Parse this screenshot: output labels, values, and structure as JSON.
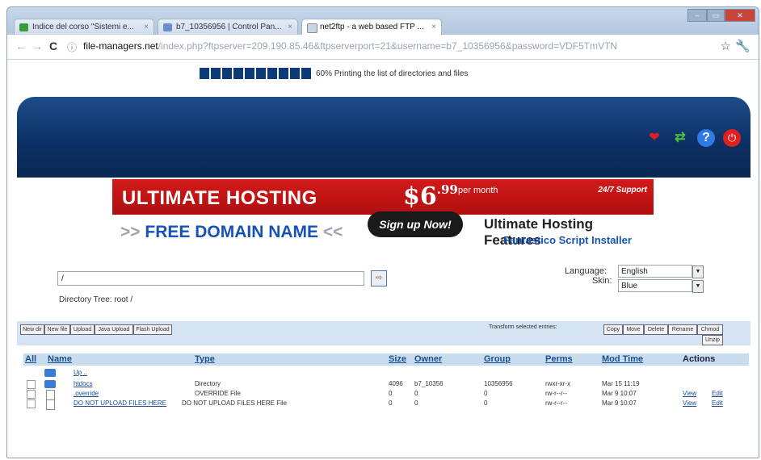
{
  "window": {
    "controls": [
      "–",
      "▭",
      "✕"
    ]
  },
  "tabs": [
    {
      "label": "Indice del corso \"Sistemi e...",
      "close": "×"
    },
    {
      "label": "b7_10356956 | Control Pan...",
      "close": "×"
    },
    {
      "label": "net2ftp - a web based FTP ...",
      "close": "×"
    }
  ],
  "address": {
    "host": "file-managers.net",
    "path": "/index.php?ftpserver=209.190.85.46&ftpserverport=21&username=b7_10356956&password=VDF5TmVTN",
    "back": "←",
    "forward": "→",
    "reload": "C",
    "star": "☆",
    "wrench": "🔧"
  },
  "progress": {
    "percent": 60,
    "segments_filled": 10,
    "text": "60% Printing the list of directories and files"
  },
  "header_icons": {
    "heart": "❤",
    "refresh": "⇄",
    "help": "?",
    "power": "⏻"
  },
  "banner": {
    "headline": "ULTIMATE HOSTING",
    "price": "$6",
    "cents": ".99",
    "per_month": "per month",
    "support": "24/7 Support",
    "free_domain": "FREE DOMAIN NAME",
    "chev_left": ">>",
    "chev_right": "<<",
    "signup": "Sign up Now!",
    "features": "Ultimate Hosting Features",
    "installer": "Fantastico Script Installer"
  },
  "path_input": {
    "value": "/",
    "go": "⇨"
  },
  "directory_tree": "Directory Tree: root /",
  "language": {
    "label": "Language:",
    "value": "English"
  },
  "skin": {
    "label": "Skin:",
    "value": "Blue"
  },
  "action_buttons": [
    "New dir",
    "New file",
    "Upload",
    "Java Upload",
    "Flash Upload"
  ],
  "transform_label": "Transform selected entries:",
  "transform_buttons": [
    "Copy",
    "Move",
    "Delete",
    "Rename",
    "Chmod",
    "Unzip"
  ],
  "table": {
    "headers": {
      "all": "All",
      "name": "Name",
      "type": "Type",
      "size": "Size",
      "owner": "Owner",
      "group": "Group",
      "perms": "Perms",
      "mod": "Mod Time",
      "actions": "Actions"
    },
    "rows": [
      {
        "name": "Up ..",
        "type": "",
        "size": "",
        "owner": "",
        "group": "",
        "perms": "",
        "mod": "",
        "view": "",
        "edit": ""
      },
      {
        "name": "htdocs",
        "type": "Directory",
        "size": "4096",
        "owner": "b7_10356",
        "group": "10356956",
        "perms": "rwxr-xr-x",
        "mod": "Mar 15 11:19",
        "view": "",
        "edit": ""
      },
      {
        "name": ".override",
        "type": "OVERRIDE File",
        "size": "0",
        "owner": "0",
        "group": "0",
        "perms": "rw-r--r--",
        "mod": "Mar 9 10:07",
        "view": "View",
        "edit": "Edit"
      },
      {
        "name": "DO NOT UPLOAD FILES HERE",
        "type": "DO NOT UPLOAD FILES HERE File",
        "size": "0",
        "owner": "0",
        "group": "0",
        "perms": "rw-r--r--",
        "mod": "Mar 9 10:07",
        "view": "View",
        "edit": "Edit"
      }
    ]
  },
  "colors": {
    "header_blue": "#0c2f63",
    "banner_red": "#c31414",
    "link_blue": "#1b4e8f",
    "progress_blue": "#0d3a78"
  }
}
